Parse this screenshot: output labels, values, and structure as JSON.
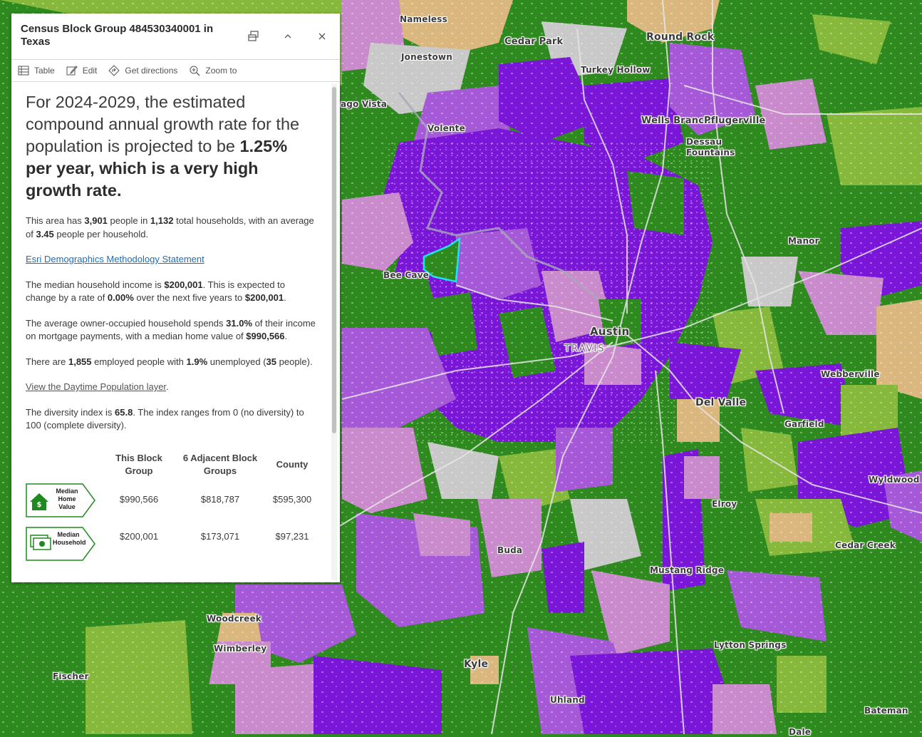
{
  "panel": {
    "title": "Census Block Group 484530340001 in Texas",
    "actions": {
      "table": "Table",
      "edit": "Edit",
      "directions": "Get directions",
      "zoom": "Zoom to"
    },
    "lead": {
      "pre": "For 2024-2029, the estimated compound annual growth rate for the population is projected to be",
      "bold": "1.25% per year, which is a very high growth rate."
    },
    "p1": {
      "t1": "This area has ",
      "people": "3,901",
      "t2": " people in ",
      "households": "1,132",
      "t3": " total households, with an average of ",
      "avg": "3.45",
      "t4": " people per household."
    },
    "methodology_link": "Esri Demographics Methodology Statement",
    "p2": {
      "t1": "The median household income is ",
      "income": "$200,001",
      "t2": ". This is expected to change by a rate of ",
      "rate": "0.00%",
      "t3": " over the next five years to ",
      "future": "$200,001",
      "t4": "."
    },
    "p3": {
      "t1": "The average owner-occupied household spends ",
      "pct": "31.0%",
      "t2": " of their income on mortgage payments, with a median home value of ",
      "value": "$990,566",
      "t3": "."
    },
    "p4": {
      "t1": "There are ",
      "employed": "1,855",
      "t2": " employed people with ",
      "unemp": "1.9%",
      "t3": " unemployed (",
      "unemp_count": "35",
      "t4": " people)."
    },
    "daytime_link": "View the Daytime Population layer",
    "daytime_end": ".",
    "p5": {
      "t1": "The diversity index is ",
      "index": "65.8",
      "t2": ". The index ranges from 0 (no diversity) to 100 (complete diversity)."
    },
    "table": {
      "headers": [
        "This Block Group",
        "6 Adjacent Block Groups",
        "County"
      ],
      "rows": [
        {
          "label": "Median Home Value",
          "label_l1": "Median",
          "label_l2": "Home",
          "label_l3": "Value",
          "values": [
            "$990,566",
            "$818,787",
            "$595,300"
          ]
        },
        {
          "label": "Median Household Income",
          "label_l1": "Median",
          "label_l2": "Household",
          "values": [
            "$200,001",
            "$173,071",
            "$97,231"
          ]
        }
      ]
    }
  },
  "map": {
    "places": [
      "Nameless",
      "Cedar Park",
      "Round Rock",
      "Jonestown",
      "Turkey Hollow",
      "ago Vista",
      "Volente",
      "Wells Branch",
      "Pflugerville",
      "Dessau",
      "Fountains",
      "Manor",
      "Bee Cave",
      "Austin",
      "TRAVIS",
      "Webberville",
      "Del Valle",
      "Garfield",
      "Wyldwood",
      "Elroy",
      "Cedar Creek",
      "Buda",
      "Mustang Ridge",
      "Woodcreek",
      "Wimberley",
      "Lytton Springs",
      "Fischer",
      "Kyle",
      "Uhland",
      "Bateman",
      "Dale"
    ],
    "colors": {
      "very_high": "#7a16d8",
      "high": "#a559d6",
      "moderate": "#c98bcc",
      "low": "#d9b77e",
      "declining_light": "#86b83c",
      "declining": "#2e8a1e",
      "urban_gray": "#c9c9c9",
      "selection": "#19e3f2"
    }
  }
}
